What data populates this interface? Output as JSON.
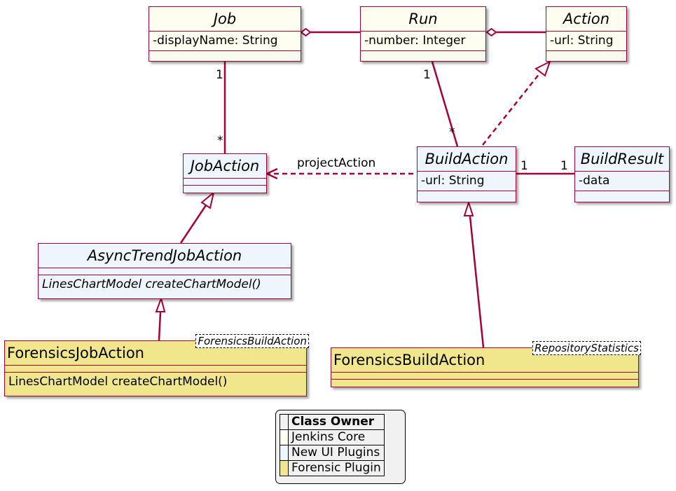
{
  "colors": {
    "line": "#A80036",
    "jenkins_core_fill": "#FEFEF0",
    "new_ui_plugins_fill": "#EEF5FC",
    "forensic_plugin_fill": "#F0E68C",
    "legend_bg": "#F1F1F1"
  },
  "classes": {
    "job": {
      "name": "Job",
      "attributes": [
        "-displayName: String"
      ],
      "owner": "Jenkins Core"
    },
    "run": {
      "name": "Run",
      "attributes": [
        "-number: Integer"
      ],
      "owner": "Jenkins Core"
    },
    "action": {
      "name": "Action",
      "attributes": [
        "-url: String"
      ],
      "owner": "Jenkins Core"
    },
    "job_action": {
      "name": "JobAction",
      "owner": "Jenkins Core"
    },
    "build_action": {
      "name": "BuildAction",
      "attributes": [
        "-url: String"
      ],
      "owner": "New UI Plugins"
    },
    "build_result": {
      "name": "BuildResult",
      "attributes": [
        "-data"
      ],
      "owner": "New UI Plugins"
    },
    "async_trend_job_action": {
      "name": "AsyncTrendJobAction",
      "methods": [
        "LinesChartModel createChartModel()"
      ],
      "owner": "New UI Plugins"
    },
    "forensics_job_action": {
      "name": "ForensicsJobAction",
      "type_param": "ForensicsBuildAction",
      "methods": [
        "LinesChartModel createChartModel()"
      ],
      "owner": "Forensic Plugin"
    },
    "forensics_build_action": {
      "name": "ForensicsBuildAction",
      "type_param": "RepositoryStatistics",
      "owner": "Forensic Plugin"
    }
  },
  "relations": [
    {
      "from": "Job",
      "to": "Run",
      "type": "aggregation"
    },
    {
      "from": "Run",
      "to": "Action",
      "type": "aggregation"
    },
    {
      "from": "Job",
      "to": "JobAction",
      "type": "association",
      "from_mult": "1",
      "to_mult": "*"
    },
    {
      "from": "Run",
      "to": "BuildAction",
      "type": "association",
      "from_mult": "1",
      "to_mult": "*"
    },
    {
      "from": "BuildAction",
      "to": "Action",
      "type": "realization"
    },
    {
      "from": "BuildAction",
      "to": "JobAction",
      "type": "dependency",
      "label": "projectAction"
    },
    {
      "from": "BuildAction",
      "to": "BuildResult",
      "type": "association",
      "from_mult": "1",
      "to_mult": "1"
    },
    {
      "from": "AsyncTrendJobAction",
      "to": "JobAction",
      "type": "generalization"
    },
    {
      "from": "ForensicsJobAction",
      "to": "AsyncTrendJobAction",
      "type": "generalization"
    },
    {
      "from": "ForensicsBuildAction",
      "to": "BuildAction",
      "type": "generalization"
    }
  ],
  "labels": {
    "project_action": "projectAction",
    "job_mult": "1",
    "jobaction_mult": "*",
    "run_mult": "1",
    "buildaction_mult": "*",
    "buildaction_result_mult": "1",
    "buildresult_mult": "1"
  },
  "legend": {
    "title": "Class Owner",
    "entries": [
      {
        "label": "Jenkins Core",
        "color": "#FEFEF0"
      },
      {
        "label": "New UI Plugins",
        "color": "#EEF5FC"
      },
      {
        "label": "Forensic Plugin",
        "color": "#F0E68C"
      }
    ]
  }
}
